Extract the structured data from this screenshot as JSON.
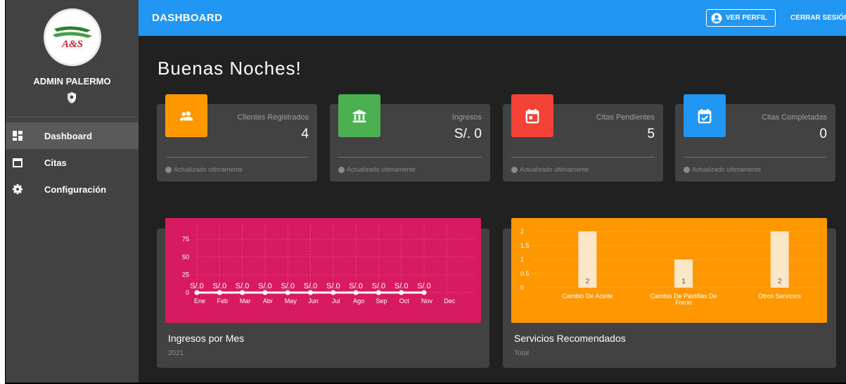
{
  "header": {
    "title": "DASHBOARD",
    "profile_label": "VER PERFIL",
    "logout_label": "CERRAR SESIÓN"
  },
  "sidebar": {
    "logo_text": "A&S",
    "user_name": "ADMIN PALERMO",
    "items": [
      {
        "label": "Dashboard",
        "icon": "dashboard-icon",
        "active": true
      },
      {
        "label": "Citas",
        "icon": "calendar-icon",
        "active": false
      },
      {
        "label": "Configuración",
        "icon": "gear-icon",
        "active": false
      }
    ]
  },
  "greeting": "Buenas Noches!",
  "cards": [
    {
      "label": "Clientes Registrados",
      "value": "4",
      "footer": "Actualizado ultimamente",
      "color": "#ff9800",
      "icon": "users-icon"
    },
    {
      "label": "Ingresos",
      "value": "S/. 0",
      "footer": "Actualizado ultimamente",
      "color": "#4caf50",
      "icon": "bank-icon"
    },
    {
      "label": "Citas Pendientes",
      "value": "5",
      "footer": "Actualizado ultimamente",
      "color": "#f44336",
      "icon": "calendar-pending-icon"
    },
    {
      "label": "Citas Completadas",
      "value": "0",
      "footer": "Actualizado ultimamente",
      "color": "#2196f3",
      "icon": "calendar-check-icon"
    }
  ],
  "charts": {
    "income": {
      "title": "Ingresos por Mes",
      "subtitle": "2021",
      "color": "#d81b60"
    },
    "services": {
      "title": "Servicios Recomendados",
      "subtitle": "Total",
      "color": "#ff9800"
    }
  },
  "chart_data": [
    {
      "type": "line",
      "categories": [
        "Ene",
        "Feb",
        "Mar",
        "Abr",
        "May",
        "Jun",
        "Jul",
        "Ago",
        "Sep",
        "Oct",
        "Nov",
        "Dec"
      ],
      "values": [
        0,
        0,
        0,
        0,
        0,
        0,
        0,
        0,
        0,
        0,
        0
      ],
      "point_labels": [
        "S/.0",
        "S/.0",
        "S/.0",
        "S/.0",
        "S/.0",
        "S/.0",
        "S/.0",
        "S/.0",
        "S/.0",
        "S/.0",
        "S/.0"
      ],
      "yticks": [
        0,
        25,
        50,
        75
      ],
      "ylim": [
        0,
        85
      ]
    },
    {
      "type": "bar",
      "categories": [
        [
          "Cambio De Aceite"
        ],
        [
          "Cambio De Pastillas De",
          "Freno"
        ],
        [
          "Otros Servicios"
        ]
      ],
      "values": [
        2,
        1,
        2
      ],
      "yticks": [
        0,
        0.5,
        1,
        1.5,
        2
      ],
      "ylim": [
        0,
        2
      ]
    }
  ]
}
